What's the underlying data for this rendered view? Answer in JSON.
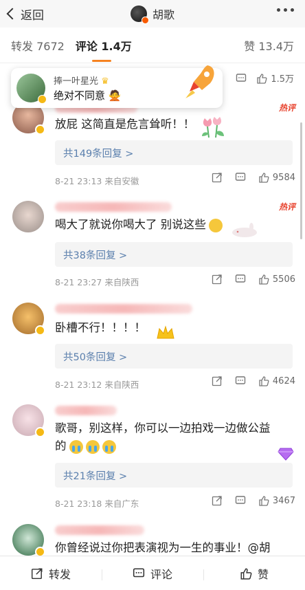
{
  "topbar": {
    "back_label": "返回",
    "title": "胡歌"
  },
  "tabs": {
    "repost": "转发 7672",
    "comment": "评论 1.4万",
    "like": "赞 13.4万"
  },
  "pinned": {
    "name": "捧一叶星光",
    "content": "绝对不同意",
    "like_count": "1.5万"
  },
  "comments": [
    {
      "text": "放屁 这简直是危言耸听！！",
      "hot": "热评",
      "reply": "共149条回复 >",
      "meta": "8-21 23:13  来自安徽",
      "likes": "9584"
    },
    {
      "text": "喝大了就说你喝大了 别说这些",
      "hot": "热评",
      "reply": "共38条回复 >",
      "meta": "8-21 23:27  来自陕西",
      "likes": "5506"
    },
    {
      "text": "卧槽不行！！！！",
      "reply": "共50条回复 >",
      "meta": "8-21 23:12  来自陕西",
      "likes": "4624"
    },
    {
      "text_line1": "歌哥，别这样，你可以一边拍戏一边做公益",
      "text_line2": "的",
      "reply": "共21条回复 >",
      "meta": "8-21 23:18  来自广东",
      "likes": "3467"
    },
    {
      "text": "你曾经说过你把表演视为一生的事业！@胡"
    }
  ],
  "bottombar": {
    "repost": "转发",
    "comment": "评论",
    "like": "赞"
  }
}
